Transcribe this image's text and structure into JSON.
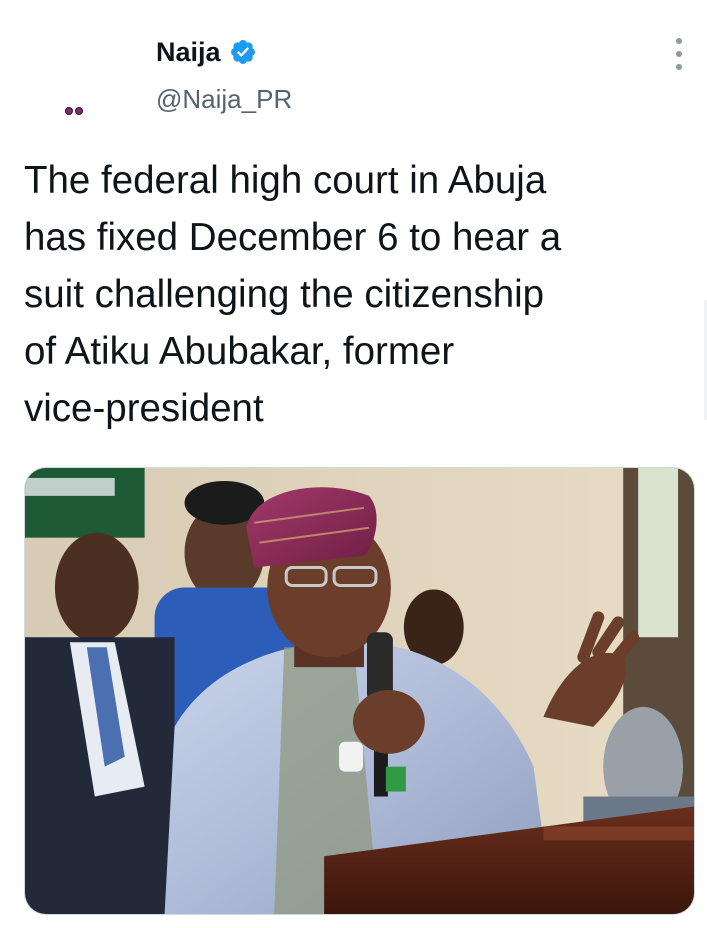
{
  "user": {
    "display_name": "Naija",
    "handle": "@Naija_PR",
    "verified": true,
    "avatar_icon": "avatar-icon"
  },
  "tweet": {
    "text": "The federal high court in Abuja\nhas fixed December 6 to hear a\nsuit challenging the citizenship\nof Atiku Abubakar, former\nvice-president"
  },
  "icons": {
    "verified": "verified-badge-icon",
    "more": "more-options-icon"
  },
  "colors": {
    "text_primary": "#0f1419",
    "text_secondary": "#536471",
    "verified_blue": "#1d9bf0",
    "media_border": "#cfd9de"
  }
}
